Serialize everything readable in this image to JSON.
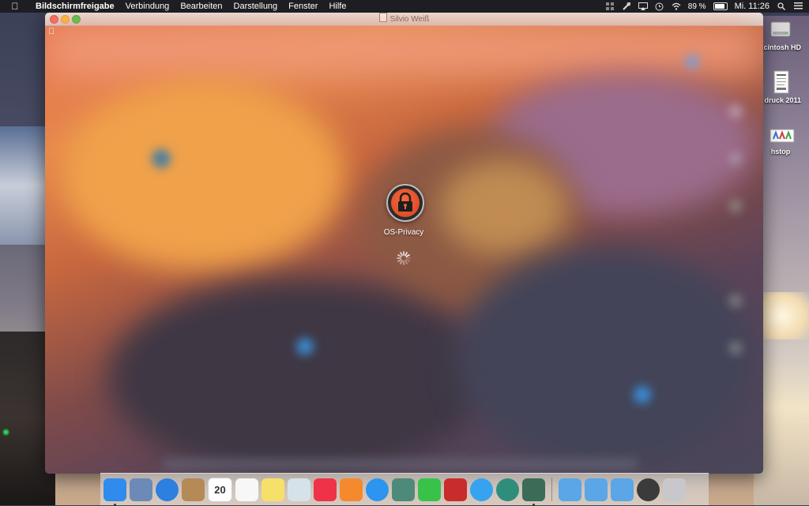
{
  "menubar": {
    "app_name": "Bildschirmfreigabe",
    "menus": [
      "Verbindung",
      "Bearbeiten",
      "Darstellung",
      "Fenster",
      "Hilfe"
    ],
    "battery_percent": "89 %",
    "battery_level": 0.89,
    "clock": "Mi. 11:26",
    "status_icons": [
      "grid-icon",
      "tools-icon",
      "airplay-icon",
      "time-machine-icon",
      "wifi-icon",
      "battery-icon",
      "search-icon",
      "list-icon"
    ]
  },
  "desktop": {
    "icons": [
      {
        "label": "acintosh HD",
        "icon": "hard-drive-icon"
      },
      {
        "label": "druck 2011",
        "icon": "document-icon"
      },
      {
        "label": "hstop",
        "icon": "app-icon"
      }
    ]
  },
  "window": {
    "title": "Silvio Weiß",
    "remote_user": "OS-Privacy"
  },
  "dock": {
    "items": [
      {
        "name": "finder",
        "color": "#2f8bee",
        "running": true
      },
      {
        "name": "preview",
        "color": "#6c8ab8",
        "running": false
      },
      {
        "name": "safari",
        "color": "#2d7fe0",
        "running": false
      },
      {
        "name": "contacts",
        "color": "#b48a56",
        "running": false
      },
      {
        "name": "calendar",
        "color": "#ffffff",
        "label": "20",
        "running": false
      },
      {
        "name": "reminders",
        "color": "#f7f7f7",
        "running": false
      },
      {
        "name": "notes",
        "color": "#f6e06a",
        "running": false
      },
      {
        "name": "photo-browser",
        "color": "#d6e2ea",
        "running": false
      },
      {
        "name": "itunes",
        "color": "#f03248",
        "running": false
      },
      {
        "name": "ibooks",
        "color": "#f5892e",
        "running": false
      },
      {
        "name": "app-store",
        "color": "#2b95ef",
        "running": false
      },
      {
        "name": "iphoto",
        "color": "#4e8a7a",
        "running": false
      },
      {
        "name": "facetime",
        "color": "#38c24a",
        "running": false
      },
      {
        "name": "photo-booth",
        "color": "#c82c2c",
        "running": false
      },
      {
        "name": "messages",
        "color": "#35a3f0",
        "running": false
      },
      {
        "name": "time-machine",
        "color": "#2f8d7c",
        "running": false
      },
      {
        "name": "screen-sharing",
        "color": "#3a6c58",
        "running": true
      }
    ],
    "stacks": [
      {
        "name": "folder-1",
        "color": "#5aa6e6"
      },
      {
        "name": "folder-2",
        "color": "#5aa6e6"
      },
      {
        "name": "folder-3",
        "color": "#5aa6e6"
      },
      {
        "name": "1password",
        "color": "#3b3b3b"
      },
      {
        "name": "trash",
        "color": "#c8c8cc"
      }
    ]
  },
  "colors": {
    "accent": "#e4744d",
    "menubar_bg": "#1e1e22"
  }
}
